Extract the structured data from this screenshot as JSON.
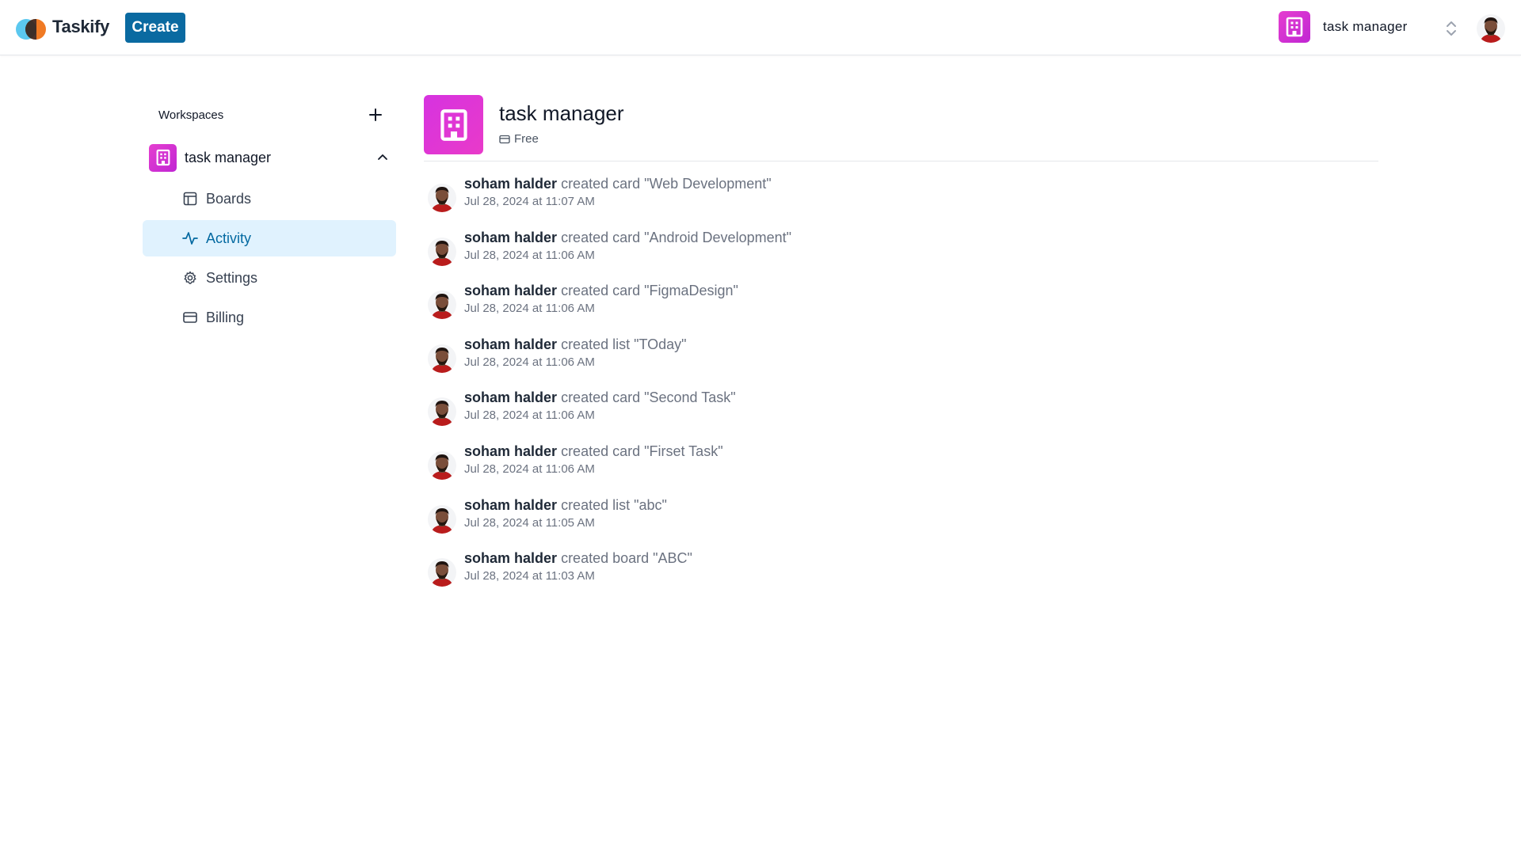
{
  "app": {
    "name": "Taskify",
    "create_label": "Create"
  },
  "org_switcher": {
    "name": "task manager"
  },
  "sidebar": {
    "title": "Workspaces",
    "workspace": {
      "name": "task manager"
    },
    "items": [
      {
        "label": "Boards",
        "icon": "layout-icon"
      },
      {
        "label": "Activity",
        "icon": "activity-icon",
        "active": true
      },
      {
        "label": "Settings",
        "icon": "gear-icon"
      },
      {
        "label": "Billing",
        "icon": "credit-card-icon"
      }
    ]
  },
  "org": {
    "name": "task manager",
    "plan": "Free"
  },
  "activity": [
    {
      "user": "soham halder",
      "action": "created card \"Web Development\"",
      "time": "Jul 28, 2024 at 11:07 AM"
    },
    {
      "user": "soham halder",
      "action": "created card \"Android Development\"",
      "time": "Jul 28, 2024 at 11:06 AM"
    },
    {
      "user": "soham halder",
      "action": "created card \"FigmaDesign\"",
      "time": "Jul 28, 2024 at 11:06 AM"
    },
    {
      "user": "soham halder",
      "action": "created list \"TOday\"",
      "time": "Jul 28, 2024 at 11:06 AM"
    },
    {
      "user": "soham halder",
      "action": "created card \"Second Task\"",
      "time": "Jul 28, 2024 at 11:06 AM"
    },
    {
      "user": "soham halder",
      "action": "created card \"Firset Task\"",
      "time": "Jul 28, 2024 at 11:06 AM"
    },
    {
      "user": "soham halder",
      "action": "created list \"abc\"",
      "time": "Jul 28, 2024 at 11:05 AM"
    },
    {
      "user": "soham halder",
      "action": "created board \"ABC\"",
      "time": "Jul 28, 2024 at 11:03 AM"
    }
  ],
  "colors": {
    "accent": "#0a6aa1",
    "org_icon": "#d633e0",
    "active_bg": "#e0f2fe",
    "active_text": "#0369a1"
  }
}
